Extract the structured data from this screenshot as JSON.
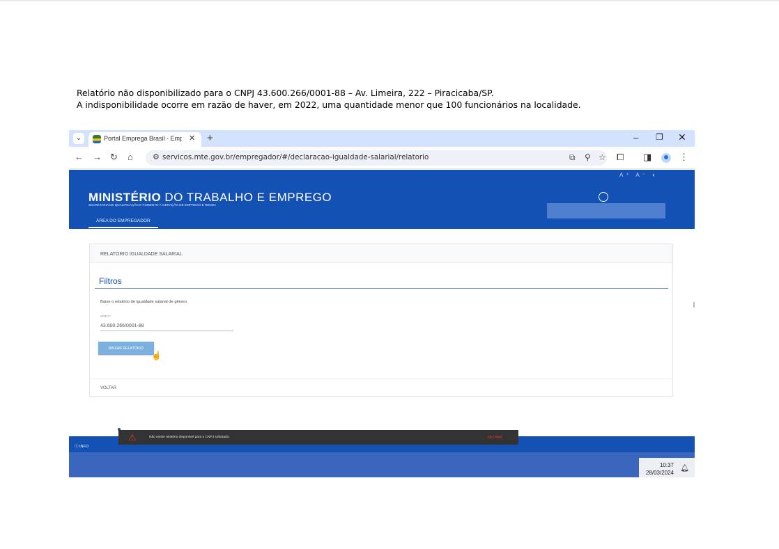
{
  "caption": {
    "line1": "Relatório não disponibilizado para o CNPJ 43.600.266/0001-88 – Av. Limeira, 222 – Piracicaba/SP.",
    "line2": "A indisponibilidade ocorre em razão de haver, em 2022, uma quantidade menor que 100 funcionários na localidade."
  },
  "browser": {
    "tab_title": "Portal Emprega Brasil - Empreg",
    "url": "servicos.mte.gov.br/empregador/#/declaracao-igualdade-salarial/relatorio"
  },
  "header": {
    "accessibility": "A⁺ A⁻ ◐",
    "brand_bold": "MINISTÉRIO",
    "brand_rest": " DO TRABALHO E EMPREGO",
    "subtitle": "SECRETARIA DE QUALIFICAÇÃO E FOMENTO À GERAÇÃO DE EMPREGO E RENDA",
    "area_tab": "ÁREA DO EMPREGADOR"
  },
  "card": {
    "title": "RELATÓRIO IGUALDADE SALARIAL",
    "filters_title": "Filtros",
    "description": "Baixe o relatório de igualdade salarial de gênero",
    "cnpj_label": "CNPJ *",
    "cnpj_value": "43.600.266/0001-88",
    "download_button": "BAIXAR RELATÓRIO",
    "back_link": "VOLTAR"
  },
  "footer": {
    "info": "ⓘ INFO"
  },
  "toast": {
    "message": "Não existe relatório disponível para o CNPJ solicitado.",
    "close": "FECHAR"
  },
  "taskbar": {
    "time": "10:37",
    "date": "28/03/2024"
  },
  "colors": {
    "gov_blue": "#1351b4",
    "toast_bg": "#333333",
    "alert_red": "#e53935"
  }
}
